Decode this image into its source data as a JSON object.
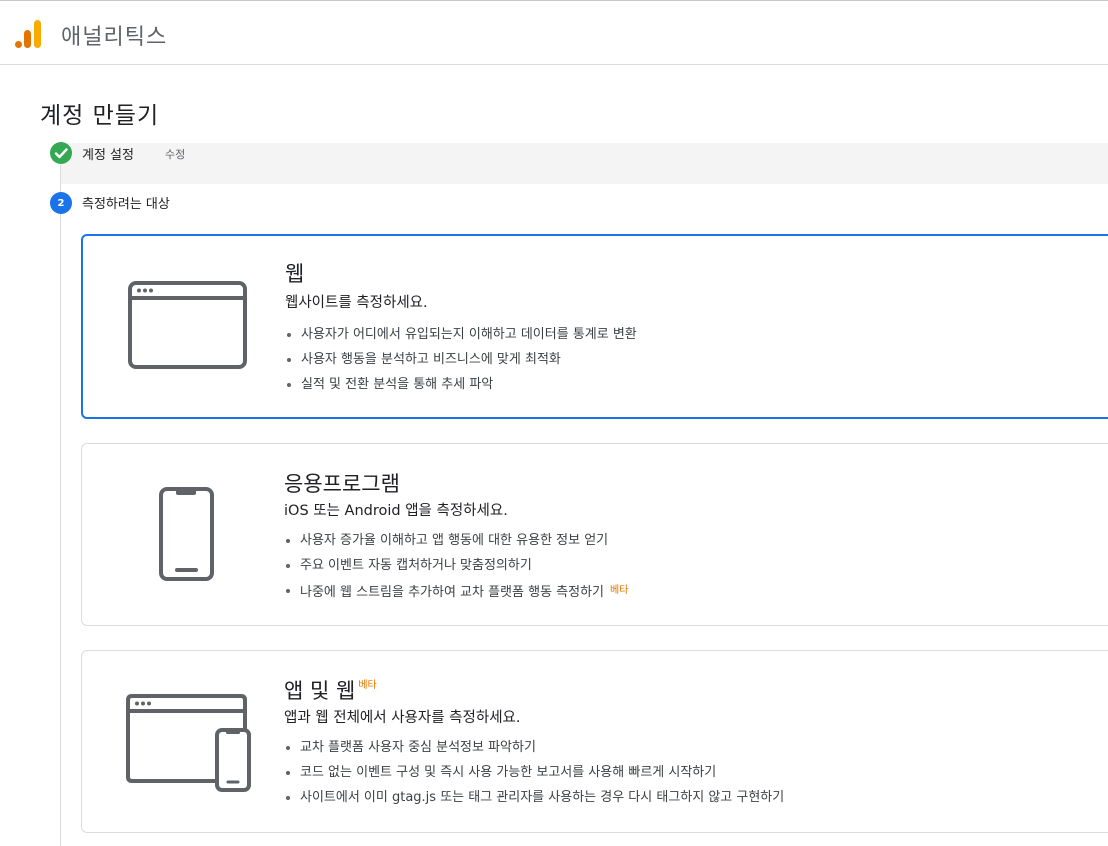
{
  "app": {
    "title": "애널리틱스"
  },
  "page": {
    "title": "계정 만들기"
  },
  "steps": [
    {
      "number": "",
      "label": "계정 설정",
      "action": "수정",
      "state": "complete"
    },
    {
      "number": "2",
      "label": "측정하려는 대상",
      "state": "active"
    }
  ],
  "options": [
    {
      "title": "웹",
      "subtitle": "웹사이트를 측정하세요.",
      "bullets": [
        "사용자가 어디에서 유입되는지 이해하고 데이터를 통계로 변환",
        "사용자 행동을 분석하고 비즈니스에 맞게 최적화",
        "실적 및 전환 분석을 통해 추세 파악"
      ],
      "selected": true,
      "icon": "browser-window-icon"
    },
    {
      "title": "응용프로그램",
      "subtitle": "iOS 또는 Android 앱을 측정하세요.",
      "bullets": [
        "사용자 증가율 이해하고 앱 행동에 대한 유용한 정보 얻기",
        "주요 이벤트 자동 캡처하거나 맞춤정의하기",
        "나중에 웹 스트림을 추가하여 교차 플랫폼 행동 측정하기"
      ],
      "bullet_badge": "베타",
      "selected": false,
      "icon": "mobile-phone-icon"
    },
    {
      "title": "앱 및 웹",
      "title_badge": "베타",
      "subtitle": "앱과 웹 전체에서 사용자를 측정하세요.",
      "bullets": [
        "교차 플랫폼 사용자 중심 분석정보 파악하기",
        "코드 없는 이벤트 구성 및 즉시 사용 가능한 보고서를 사용해 빠르게 시작하기",
        "사이트에서 이미 gtag.js 또는 태그 관리자를 사용하는 경우 다시 태그하지 않고 구현하기"
      ],
      "selected": false,
      "icon": "browser-and-phone-icon"
    }
  ],
  "colors": {
    "accent": "#1a73e8",
    "complete": "#34a853",
    "beta": "#e37400",
    "logo_dark": "#e37400",
    "logo_light": "#f9ab00"
  }
}
